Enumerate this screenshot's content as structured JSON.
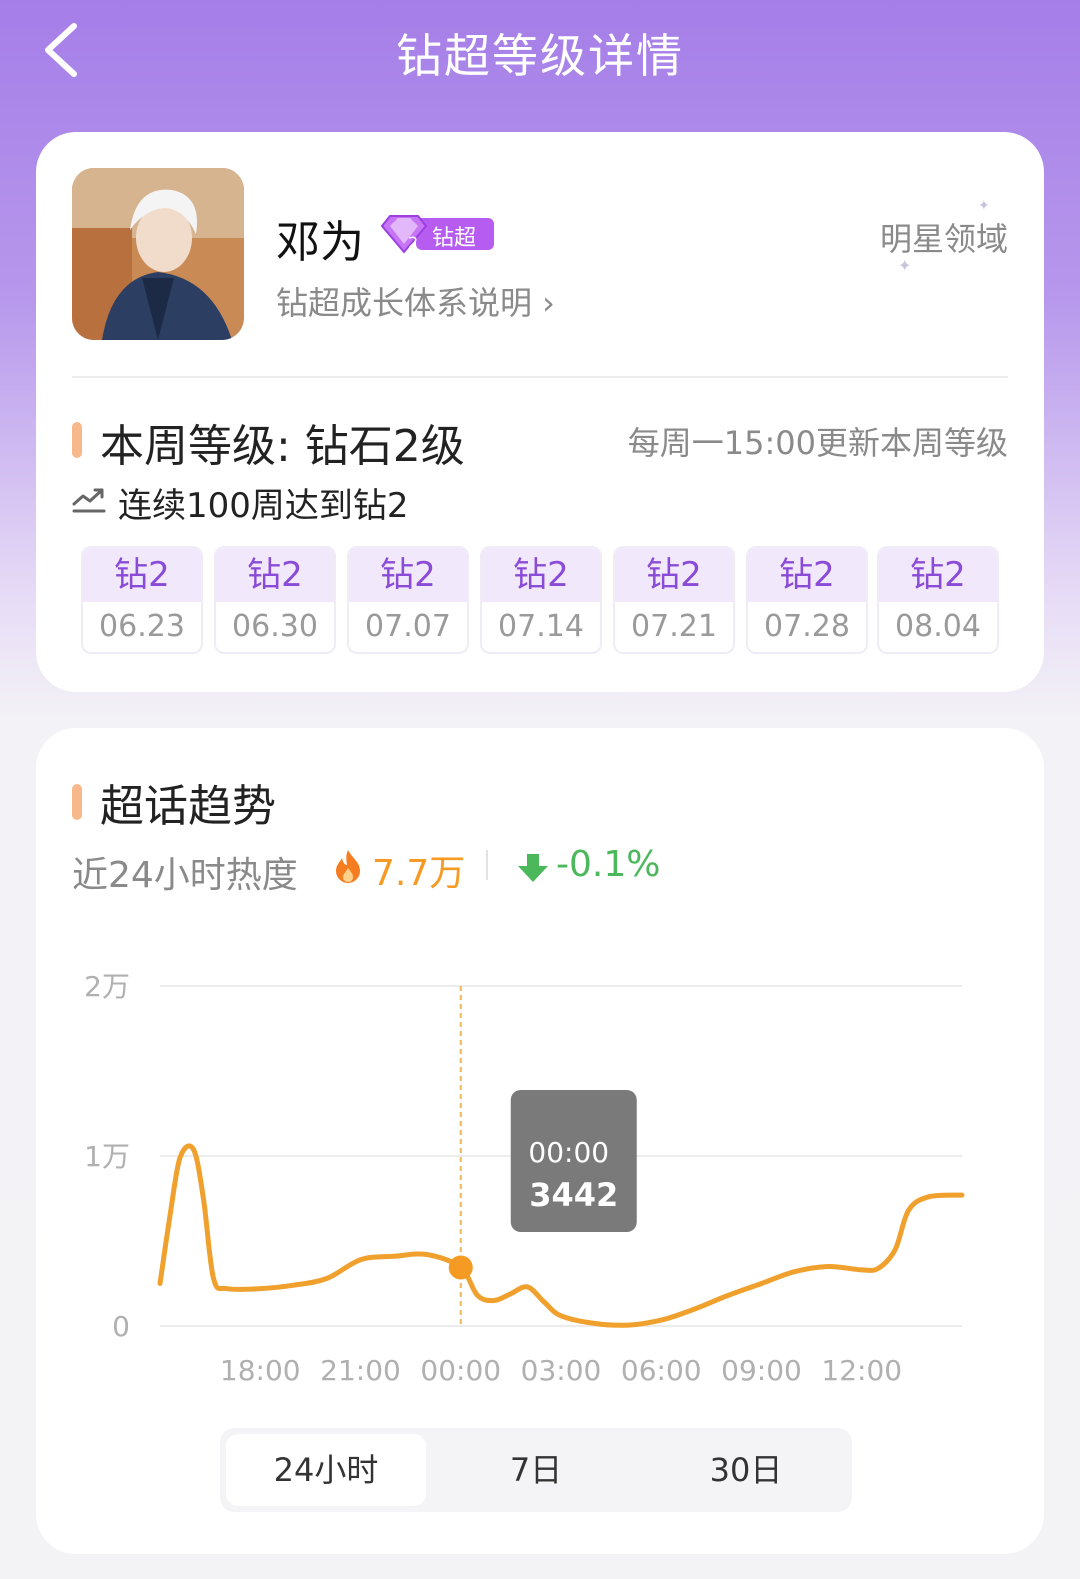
{
  "header": {
    "title": "钻超等级详情"
  },
  "profile": {
    "name": "邓为",
    "badge_label": "钻超",
    "badge_level": "2",
    "growth_link": "钻超成长体系说明 ›",
    "domain_label": "明星领域"
  },
  "level": {
    "title": "本周等级: 钻石2级",
    "update_note": "每周一15:00更新本周等级",
    "streak": "连续100周达到钻2",
    "weeks": [
      {
        "level": "钻2",
        "date": "06.23"
      },
      {
        "level": "钻2",
        "date": "06.30"
      },
      {
        "level": "钻2",
        "date": "07.07"
      },
      {
        "level": "钻2",
        "date": "07.14"
      },
      {
        "level": "钻2",
        "date": "07.21"
      },
      {
        "level": "钻2",
        "date": "07.28"
      },
      {
        "level": "钻2",
        "date": "08.04"
      }
    ]
  },
  "trend": {
    "title": "超话趋势",
    "heat_label": "近24小时热度",
    "heat_value": "7.7万",
    "heat_change": "-0.1%",
    "range_tabs": [
      "24小时",
      "7日",
      "30日"
    ],
    "active_tab": "24小时"
  },
  "tooltip": {
    "time": "00:00",
    "value": "3442"
  },
  "colors": {
    "line": "#f0a02c",
    "badge": "#b65cf0",
    "down": "#4cb85c",
    "accent": "#f7b98c"
  },
  "chart_data": {
    "type": "line",
    "x_ticks": [
      "18:00",
      "21:00",
      "00:00",
      "03:00",
      "06:00",
      "09:00",
      "12:00"
    ],
    "y_ticks": [
      "0",
      "1万",
      "2万"
    ],
    "ylim": [
      0,
      20000
    ],
    "xlim_hours": [
      15,
      39
    ],
    "series": [
      {
        "points": [
          [
            15.0,
            2500
          ],
          [
            15.3,
            6500
          ],
          [
            15.6,
            9900
          ],
          [
            16.0,
            10400
          ],
          [
            16.3,
            7500
          ],
          [
            16.6,
            2800
          ],
          [
            17.0,
            2200
          ],
          [
            18.0,
            2200
          ],
          [
            19.0,
            2400
          ],
          [
            20.0,
            2800
          ],
          [
            21.0,
            3900
          ],
          [
            22.0,
            4100
          ],
          [
            23.0,
            4200
          ],
          [
            24.0,
            3442
          ],
          [
            24.5,
            1800
          ],
          [
            25.0,
            1500
          ],
          [
            25.5,
            1900
          ],
          [
            26.0,
            2300
          ],
          [
            26.5,
            1400
          ],
          [
            27.0,
            600
          ],
          [
            28.0,
            150
          ],
          [
            29.0,
            50
          ],
          [
            30.0,
            350
          ],
          [
            31.0,
            1000
          ],
          [
            32.0,
            1800
          ],
          [
            33.0,
            2500
          ],
          [
            34.0,
            3200
          ],
          [
            35.0,
            3500
          ],
          [
            36.0,
            3300
          ],
          [
            36.5,
            3400
          ],
          [
            37.0,
            4500
          ],
          [
            37.4,
            6800
          ],
          [
            38.0,
            7600
          ],
          [
            39.0,
            7700
          ]
        ]
      }
    ],
    "highlight": {
      "x": 24.0,
      "y": 3442,
      "label": "00:00"
    }
  }
}
